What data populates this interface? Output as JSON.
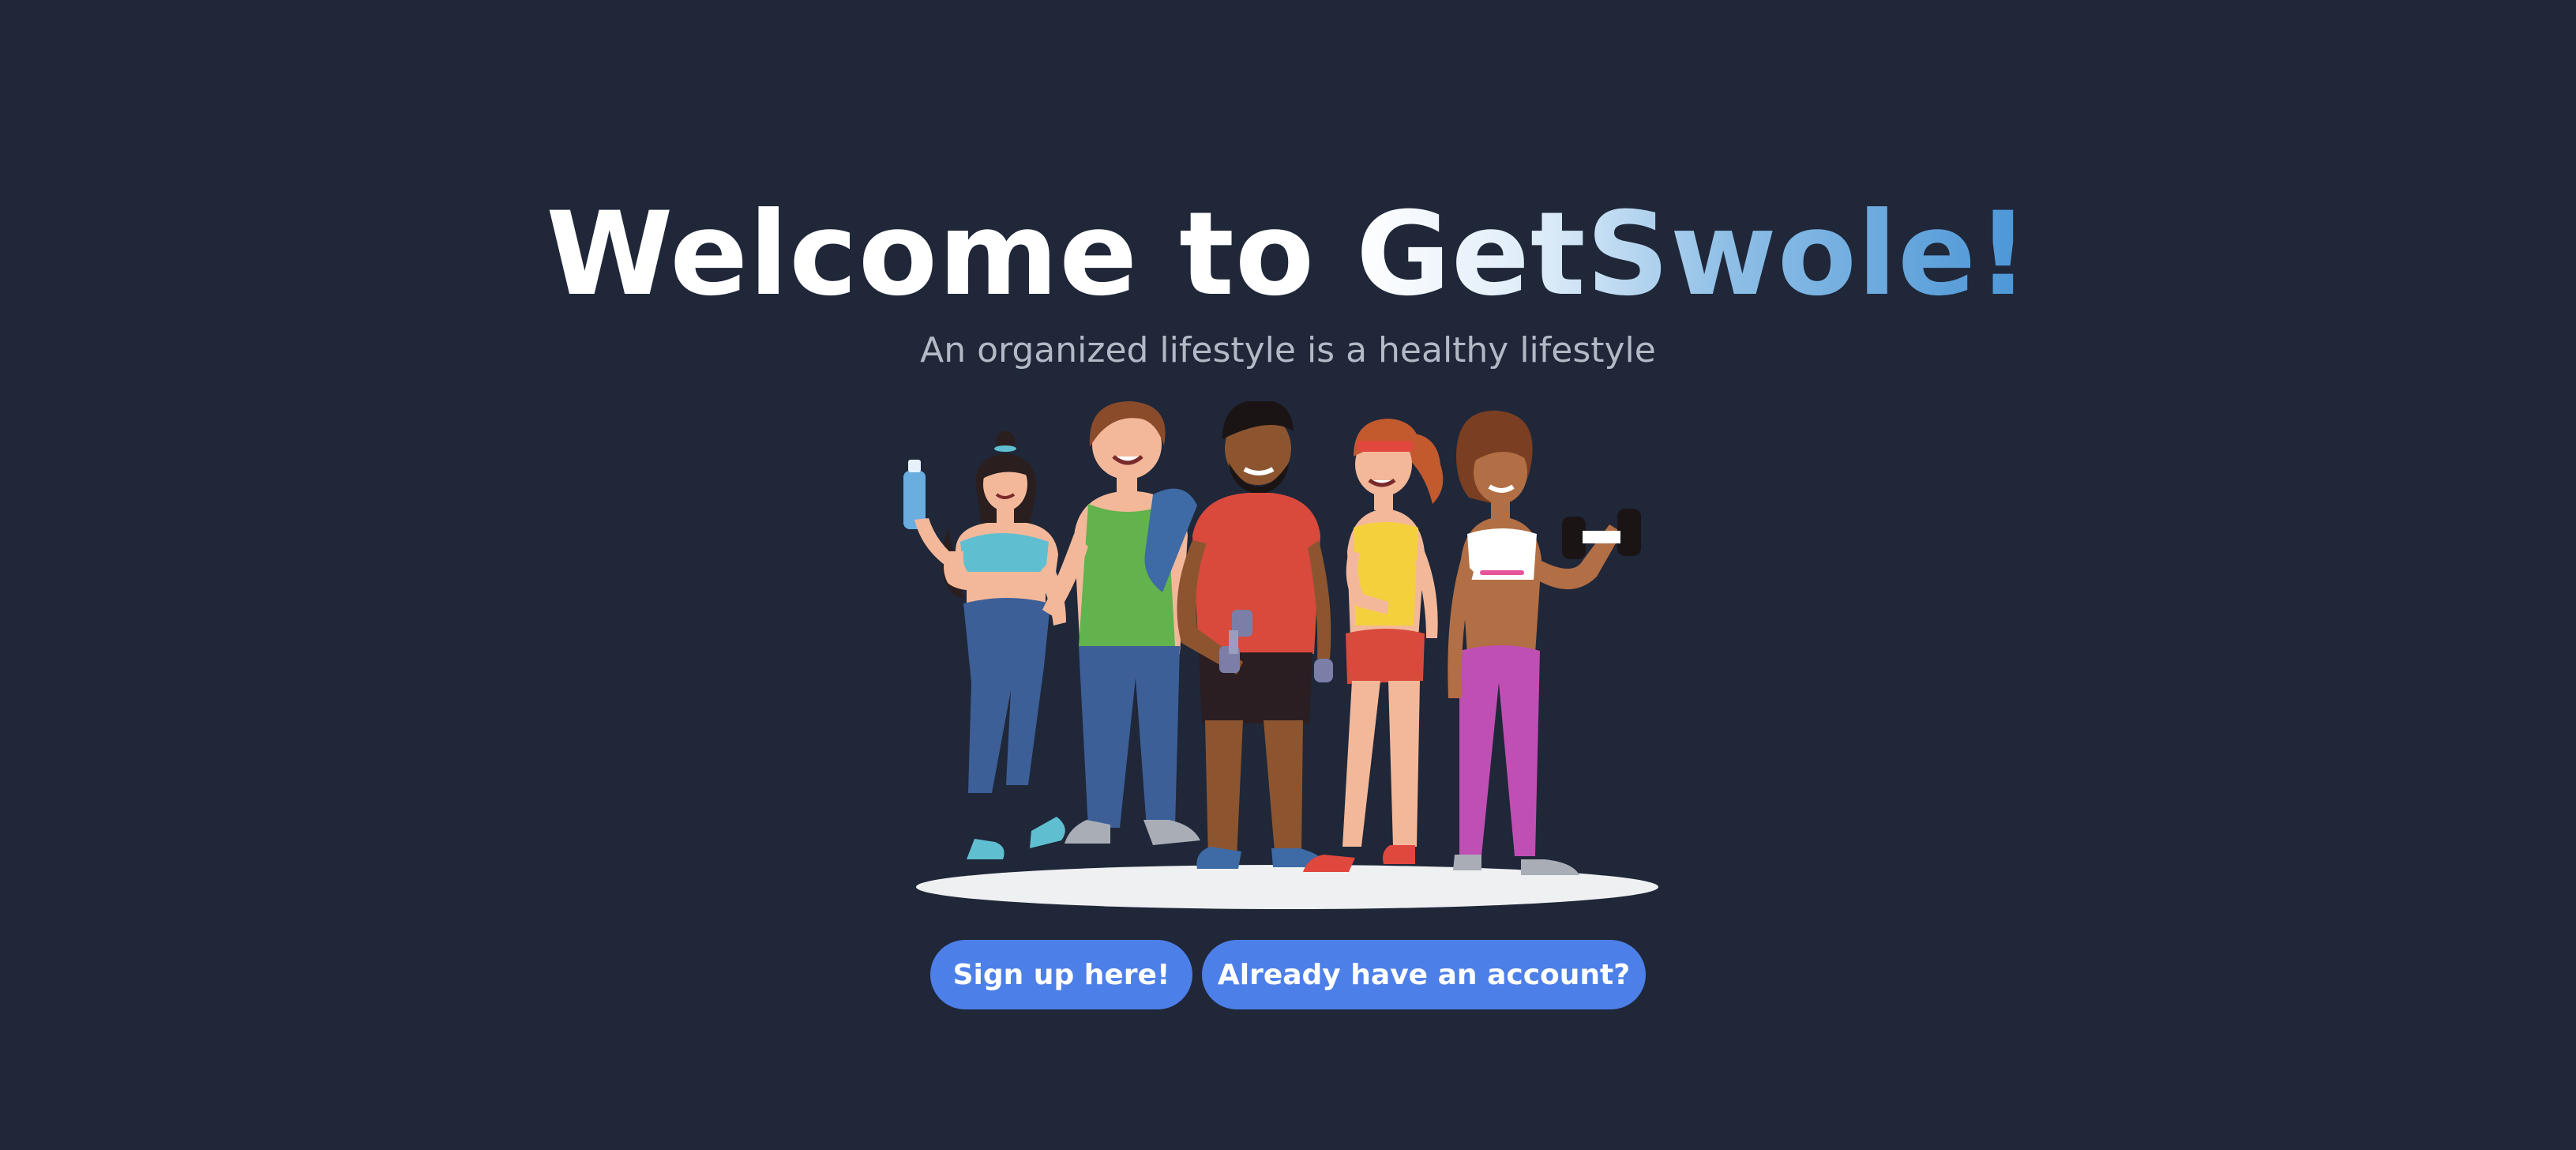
{
  "hero": {
    "title_prefix": "Welcome to ",
    "title_brand": "GetSwole!",
    "subtitle": "An organized lifestyle is a healthy lifestyle"
  },
  "illustration": {
    "icon": "fitness-group-illustration"
  },
  "actions": {
    "signup_label": "Sign up here!",
    "login_label": "Already have an account?"
  },
  "colors": {
    "background": "#1f2739",
    "button": "#4d7fe8",
    "brand_gradient_end": "#4a95d6"
  }
}
